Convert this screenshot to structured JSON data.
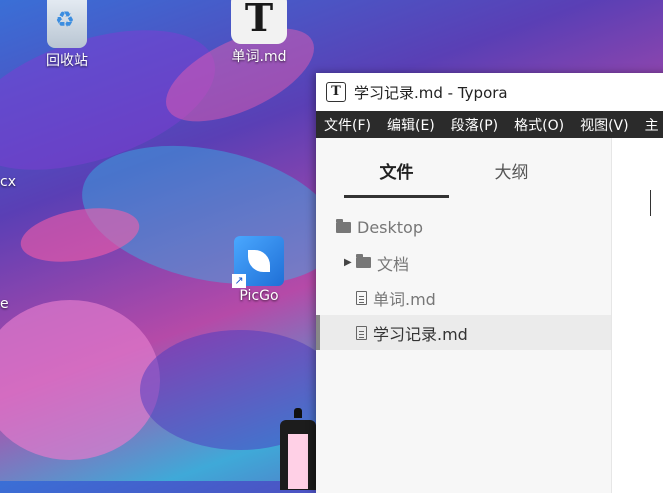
{
  "desktop": {
    "icons": [
      {
        "label": "回收站"
      },
      {
        "label": "单词.md",
        "glyph": "T"
      },
      {
        "label": "PicGo"
      }
    ],
    "edge_labels": [
      "cx",
      "e"
    ]
  },
  "window": {
    "title": "学习记录.md - Typora",
    "app_icon_glyph": "T",
    "menu": [
      "文件(F)",
      "编辑(E)",
      "段落(P)",
      "格式(O)",
      "视图(V)",
      "主"
    ],
    "sidebar": {
      "tabs": [
        {
          "label": "文件",
          "active": true
        },
        {
          "label": "大纲",
          "active": false
        }
      ],
      "tree": [
        {
          "label": "Desktop",
          "type": "folder",
          "depth": 0
        },
        {
          "label": "文档",
          "type": "folder",
          "depth": 1,
          "collapsed": true
        },
        {
          "label": "单词.md",
          "type": "file",
          "depth": 1
        },
        {
          "label": "学习记录.md",
          "type": "file",
          "depth": 1,
          "selected": true
        }
      ]
    }
  },
  "colors": {
    "menubar_bg": "#2b2b2b",
    "sidebar_bg": "#f7f7f7",
    "selected_row_bg": "#ebebeb"
  }
}
